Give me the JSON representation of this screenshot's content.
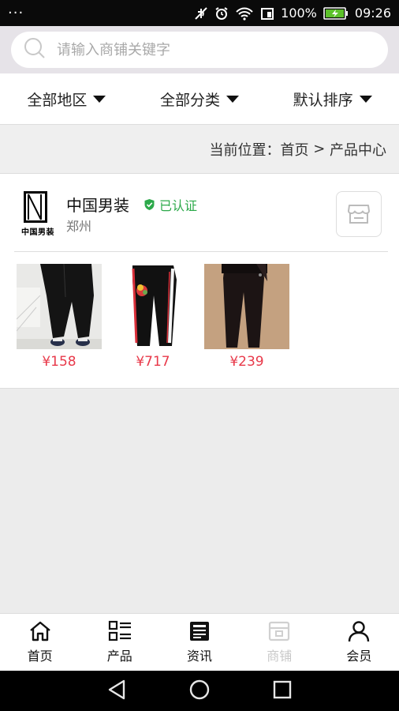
{
  "status_bar": {
    "menu_dots": "···",
    "battery_percent": "100%",
    "time": "09:26",
    "icons": [
      "mute-icon",
      "alarm-icon",
      "wifi-icon",
      "signal-icon",
      "battery-charging-icon"
    ]
  },
  "search": {
    "placeholder": "请输入商铺关键字",
    "value": ""
  },
  "filters": [
    {
      "label": "全部地区"
    },
    {
      "label": "全部分类"
    },
    {
      "label": "默认排序"
    }
  ],
  "breadcrumb": {
    "prefix": "当前位置：",
    "home": "首页",
    "separator": " > ",
    "current": "产品中心"
  },
  "shop": {
    "logo_text": "中国男装",
    "name": "中国男装",
    "verified_label": "已认证",
    "city": "郑州",
    "store_button_icon": "store-icon"
  },
  "products": [
    {
      "price": "¥158"
    },
    {
      "price": "¥717"
    },
    {
      "price": "¥239"
    }
  ],
  "tabs": [
    {
      "label": "首页",
      "icon": "home-icon",
      "enabled": true
    },
    {
      "label": "产品",
      "icon": "grid-list-icon",
      "enabled": true
    },
    {
      "label": "资讯",
      "icon": "news-icon",
      "enabled": true
    },
    {
      "label": "商铺",
      "icon": "store-icon",
      "enabled": false
    },
    {
      "label": "会员",
      "icon": "person-icon",
      "enabled": true
    }
  ],
  "colors": {
    "price": "#e8394a",
    "verified": "#2ca94a",
    "disabled_tab": "#c8c8c8"
  }
}
